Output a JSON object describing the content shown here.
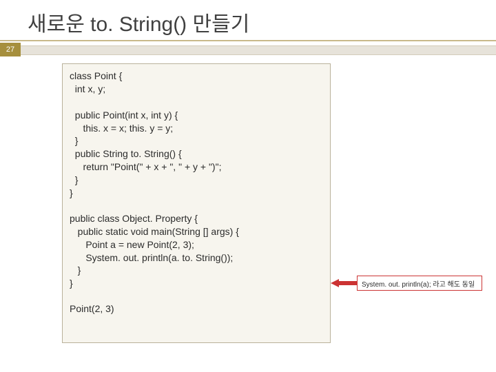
{
  "title": "새로운 to. String() 만들기",
  "page_number": "27",
  "code": {
    "block1": "class Point {\n  int x, y;\n\n  public Point(int x, int y) {\n     this. x = x; this. y = y;\n  }\n  public String to. String() {\n     return \"Point(\" + x + \", \" + y + \")\";\n  }\n}",
    "block2": "public class Object. Property {\n   public static void main(String [] args) {\n      Point a = new Point(2, 3);\n      System. out. println(a. to. String());\n   }\n}",
    "block3": "Point(2, 3)"
  },
  "callout": "System. out. println(a); 라고 해도 동일"
}
